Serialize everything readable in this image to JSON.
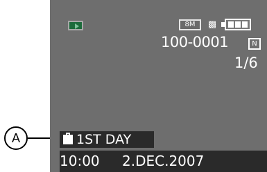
{
  "screen": {
    "play_icon": "playback-icon",
    "resolution": "8M",
    "quality_icon": "quality-icon",
    "battery_icon": "battery-icon",
    "file_number": "100-0001",
    "protect_icon": "protect-icon",
    "protect_text": "N",
    "image_count": "1/6",
    "travel_icon": "suitcase-icon",
    "travel_label": "1ST DAY",
    "time": "10:00",
    "date": "2.DEC.2007",
    "colors": {
      "screen_bg": "#6e6e6e",
      "overlay_bg": "#2a2a2a",
      "osd_text": "#ffffff",
      "play_badge": "#1c6b3b"
    }
  },
  "callout": {
    "label": "A"
  }
}
